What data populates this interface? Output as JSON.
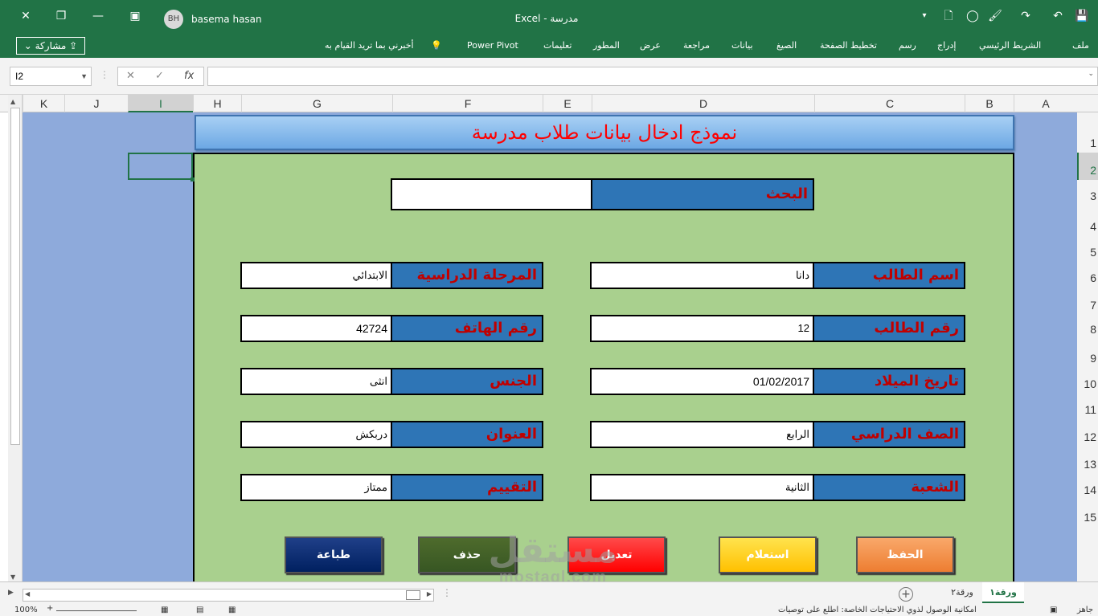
{
  "window": {
    "app_title": "Excel  -  مدرسة",
    "user_initials": "BH",
    "user_name": "basema hasan"
  },
  "ribbon": {
    "tabs": [
      "ملف",
      "الشريط الرئيسي",
      "إدراج",
      "رسم",
      "تخطيط الصفحة",
      "الصيغ",
      "بيانات",
      "مراجعة",
      "عرض",
      "المطور",
      "تعليمات",
      "Power Pivot"
    ],
    "tell_me": "أخبرني بما تريد القيام به",
    "share": "مشاركة"
  },
  "formula_bar": {
    "name_box": "I2",
    "cancel": "✕",
    "enter": "✓",
    "fx": "fx",
    "formula": ""
  },
  "columns": [
    "K",
    "J",
    "I",
    "H",
    "G",
    "F",
    "E",
    "D",
    "C",
    "B",
    "A"
  ],
  "rows": [
    "1",
    "2",
    "3",
    "4",
    "5",
    "6",
    "7",
    "8",
    "9",
    "10",
    "11",
    "12",
    "13",
    "14",
    "15"
  ],
  "form": {
    "title": "نموذج ادخال بيانات طلاب مدرسة",
    "search_label": "البحث",
    "search_value": "",
    "fields_right": [
      {
        "label": "اسم الطالب",
        "value": "دانا"
      },
      {
        "label": "رقم الطالب",
        "value": "12"
      },
      {
        "label": "تاريخ الميلاد",
        "value": "01/02/2017"
      },
      {
        "label": "الصف الدراسي",
        "value": "الرابع"
      },
      {
        "label": "الشعبة",
        "value": "الثانية"
      }
    ],
    "fields_left": [
      {
        "label": "المرحلة الدراسية",
        "value": "الابتدائي"
      },
      {
        "label": "رقم الهاتف",
        "value": "42724"
      },
      {
        "label": "الجنس",
        "value": "انثى"
      },
      {
        "label": "العنوان",
        "value": "دربكش"
      },
      {
        "label": "التقييم",
        "value": "ممتاز"
      }
    ],
    "buttons": {
      "save": "الحفظ",
      "query": "استعلام",
      "edit": "تعديل",
      "delete": "حذف",
      "print": "طباعة"
    }
  },
  "sheets": {
    "active": "ورقة١",
    "other": "ورقة٢"
  },
  "status": {
    "zoom": "100%",
    "ready": "جاهز",
    "message": "امكانية الوصول لذوي الاحتياجات الخاصة: اطلع على توصيات"
  },
  "watermark": {
    "line1": "مستقل",
    "line2": "mostaql.com"
  },
  "colors": {
    "excel_green": "#217346",
    "sheet_blue": "#8eaadb",
    "form_green": "#a9d08e",
    "label_blue": "#2e75b6",
    "label_red": "#c00000"
  }
}
